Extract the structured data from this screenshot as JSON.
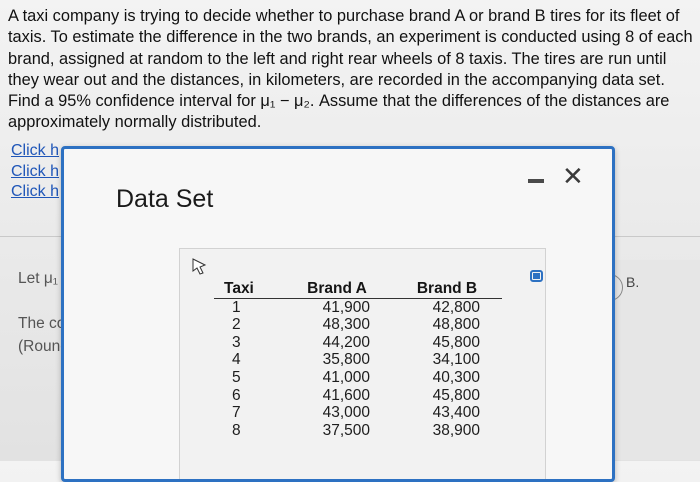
{
  "question": {
    "text": "A taxi company is trying to decide whether to purchase brand A or brand B tires for its fleet of taxis. To estimate the difference in the two brands, an experiment is conducted using 8 of each brand, assigned at random to the left and right rear wheels of 8 taxis. The tires are run until they wear out and the distances, in kilometers, are recorded in the accompanying data set. Find a 95% confidence interval for μ₁ − μ₂. Assume that the differences of the distances are approximately normally distributed."
  },
  "links": [
    "Click h",
    "Click h",
    "Click h"
  ],
  "background": {
    "let_text": "Let μ₁",
    "the_co": "The co",
    "round": "(Round",
    "choice_label": "B."
  },
  "modal": {
    "title": "Data Set",
    "table": {
      "headers": [
        "Taxi",
        "Brand A",
        "Brand B"
      ],
      "rows": [
        [
          "1",
          "41,900",
          "42,800"
        ],
        [
          "2",
          "48,300",
          "48,800"
        ],
        [
          "3",
          "44,200",
          "45,800"
        ],
        [
          "4",
          "35,800",
          "34,100"
        ],
        [
          "5",
          "41,000",
          "40,300"
        ],
        [
          "6",
          "41,600",
          "45,800"
        ],
        [
          "7",
          "43,000",
          "43,400"
        ],
        [
          "8",
          "37,500",
          "38,900"
        ]
      ]
    }
  },
  "colors": {
    "modal_border": "#2d71c2",
    "link": "#1f56b8"
  },
  "icons": [
    "minimize-icon",
    "close-icon",
    "copy-icon",
    "cursor-icon"
  ]
}
